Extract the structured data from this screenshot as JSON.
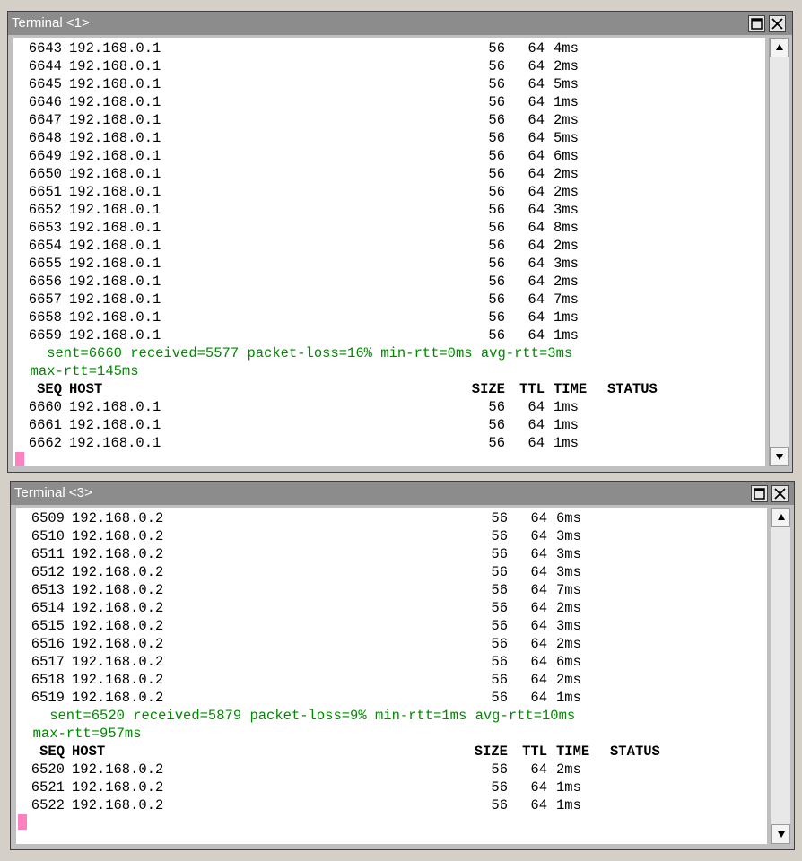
{
  "terminals": [
    {
      "title": "Terminal <1>",
      "lines_before": [
        [
          "6643",
          "192.168.0.1",
          "56",
          "64",
          "4ms",
          ""
        ],
        [
          "6644",
          "192.168.0.1",
          "56",
          "64",
          "2ms",
          ""
        ],
        [
          "6645",
          "192.168.0.1",
          "56",
          "64",
          "5ms",
          ""
        ],
        [
          "6646",
          "192.168.0.1",
          "56",
          "64",
          "1ms",
          ""
        ],
        [
          "6647",
          "192.168.0.1",
          "56",
          "64",
          "2ms",
          ""
        ],
        [
          "6648",
          "192.168.0.1",
          "56",
          "64",
          "5ms",
          ""
        ],
        [
          "6649",
          "192.168.0.1",
          "56",
          "64",
          "6ms",
          ""
        ],
        [
          "6650",
          "192.168.0.1",
          "56",
          "64",
          "2ms",
          ""
        ],
        [
          "6651",
          "192.168.0.1",
          "56",
          "64",
          "2ms",
          ""
        ],
        [
          "6652",
          "192.168.0.1",
          "56",
          "64",
          "3ms",
          ""
        ],
        [
          "6653",
          "192.168.0.1",
          "56",
          "64",
          "8ms",
          ""
        ],
        [
          "6654",
          "192.168.0.1",
          "56",
          "64",
          "2ms",
          ""
        ],
        [
          "6655",
          "192.168.0.1",
          "56",
          "64",
          "3ms",
          ""
        ],
        [
          "6656",
          "192.168.0.1",
          "56",
          "64",
          "2ms",
          ""
        ],
        [
          "6657",
          "192.168.0.1",
          "56",
          "64",
          "7ms",
          ""
        ],
        [
          "6658",
          "192.168.0.1",
          "56",
          "64",
          "1ms",
          ""
        ],
        [
          "6659",
          "192.168.0.1",
          "56",
          "64",
          "1ms",
          ""
        ]
      ],
      "summary_line1": "    sent=6660 received=5577 packet-loss=16% min-rtt=0ms avg-rtt=3ms",
      "summary_line2": "  max-rtt=145ms",
      "header": [
        "SEQ",
        "HOST",
        "SIZE",
        "TTL",
        "TIME",
        "STATUS"
      ],
      "lines_after": [
        [
          "6660",
          "192.168.0.1",
          "56",
          "64",
          "1ms",
          ""
        ],
        [
          "6661",
          "192.168.0.1",
          "56",
          "64",
          "1ms",
          ""
        ],
        [
          "6662",
          "192.168.0.1",
          "56",
          "64",
          "1ms",
          ""
        ]
      ]
    },
    {
      "title": "Terminal <3>",
      "lines_before": [
        [
          "6509",
          "192.168.0.2",
          "56",
          "64",
          "6ms",
          ""
        ],
        [
          "6510",
          "192.168.0.2",
          "56",
          "64",
          "3ms",
          ""
        ],
        [
          "6511",
          "192.168.0.2",
          "56",
          "64",
          "3ms",
          ""
        ],
        [
          "6512",
          "192.168.0.2",
          "56",
          "64",
          "3ms",
          ""
        ],
        [
          "6513",
          "192.168.0.2",
          "56",
          "64",
          "7ms",
          ""
        ],
        [
          "6514",
          "192.168.0.2",
          "56",
          "64",
          "2ms",
          ""
        ],
        [
          "6515",
          "192.168.0.2",
          "56",
          "64",
          "3ms",
          ""
        ],
        [
          "6516",
          "192.168.0.2",
          "56",
          "64",
          "2ms",
          ""
        ],
        [
          "6517",
          "192.168.0.2",
          "56",
          "64",
          "6ms",
          ""
        ],
        [
          "6518",
          "192.168.0.2",
          "56",
          "64",
          "2ms",
          ""
        ],
        [
          "6519",
          "192.168.0.2",
          "56",
          "64",
          "1ms",
          ""
        ]
      ],
      "summary_line1": "    sent=6520 received=5879 packet-loss=9% min-rtt=1ms avg-rtt=10ms",
      "summary_line2": "  max-rtt=957ms",
      "header": [
        "SEQ",
        "HOST",
        "SIZE",
        "TTL",
        "TIME",
        "STATUS"
      ],
      "lines_after": [
        [
          "6520",
          "192.168.0.2",
          "56",
          "64",
          "2ms",
          ""
        ],
        [
          "6521",
          "192.168.0.2",
          "56",
          "64",
          "1ms",
          ""
        ],
        [
          "6522",
          "192.168.0.2",
          "56",
          "64",
          "1ms",
          ""
        ]
      ]
    }
  ],
  "colors": {
    "summary_text": "#008800",
    "cursor": "#ff80c0",
    "titlebar": "#8c8c8c"
  }
}
